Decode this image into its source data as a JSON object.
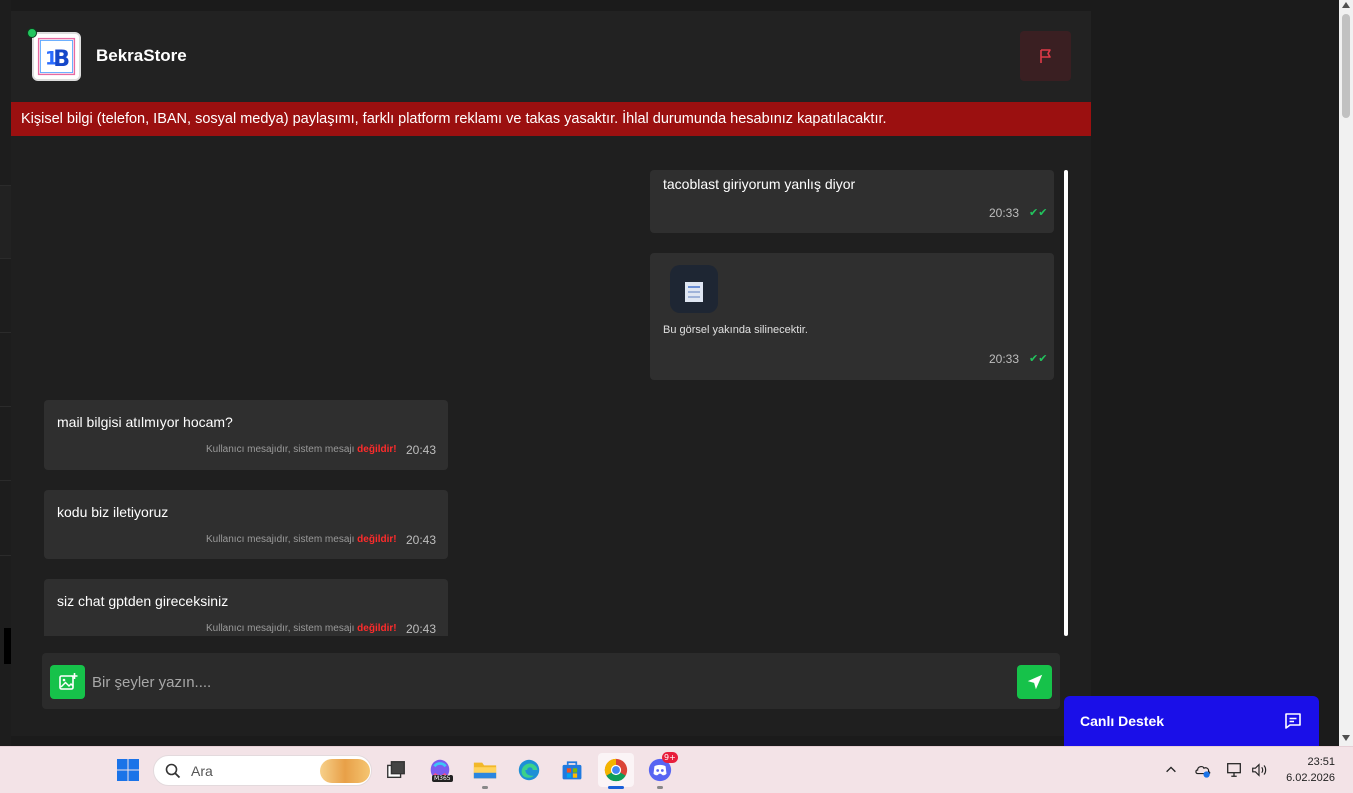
{
  "store": {
    "name": "BekraStore",
    "status": "online"
  },
  "warning_banner": "Kişisel bilgi (telefon, IBAN, sosyal medya) paylaşımı, farklı platform reklamı ve takas yasaktır. İhlal durumunda hesabınız kapatılacaktır.",
  "messages": [
    {
      "side": "outgoing",
      "text": "tacoblast giriyorum yanlış diyor",
      "time": "20:33",
      "read": true
    },
    {
      "side": "outgoing",
      "type": "image",
      "caption": "Bu görsel yakında silinecektir.",
      "time": "20:33",
      "read": true
    },
    {
      "side": "incoming",
      "text": "mail bilgisi atılmıyor hocam?",
      "note_prefix": "Kullanıcı mesajıdır, sistem mesajı ",
      "note_emph": "değildir!",
      "time": "20:43"
    },
    {
      "side": "incoming",
      "text": "kodu biz iletiyoruz",
      "note_prefix": "Kullanıcı mesajıdır, sistem mesajı ",
      "note_emph": "değildir!",
      "time": "20:43"
    },
    {
      "side": "incoming",
      "text": "siz chat gptden gireceksiniz",
      "note_prefix": "Kullanıcı mesajıdır, sistem mesajı ",
      "note_emph": "değildir!",
      "time": "20:43"
    }
  ],
  "composer": {
    "placeholder": "Bir şeyler yazın...."
  },
  "live_support": {
    "label": "Canlı Destek"
  },
  "taskbar": {
    "search_label": "Ara",
    "m365_badge": "M365",
    "discord_badge": "9+",
    "time": "23:51",
    "date": "6.02.2026"
  },
  "colors": {
    "accent_green": "#16c24a",
    "warning_red": "#9b1010",
    "support_blue": "#1a0fe8",
    "emphasis_red": "#ff2b2b"
  }
}
